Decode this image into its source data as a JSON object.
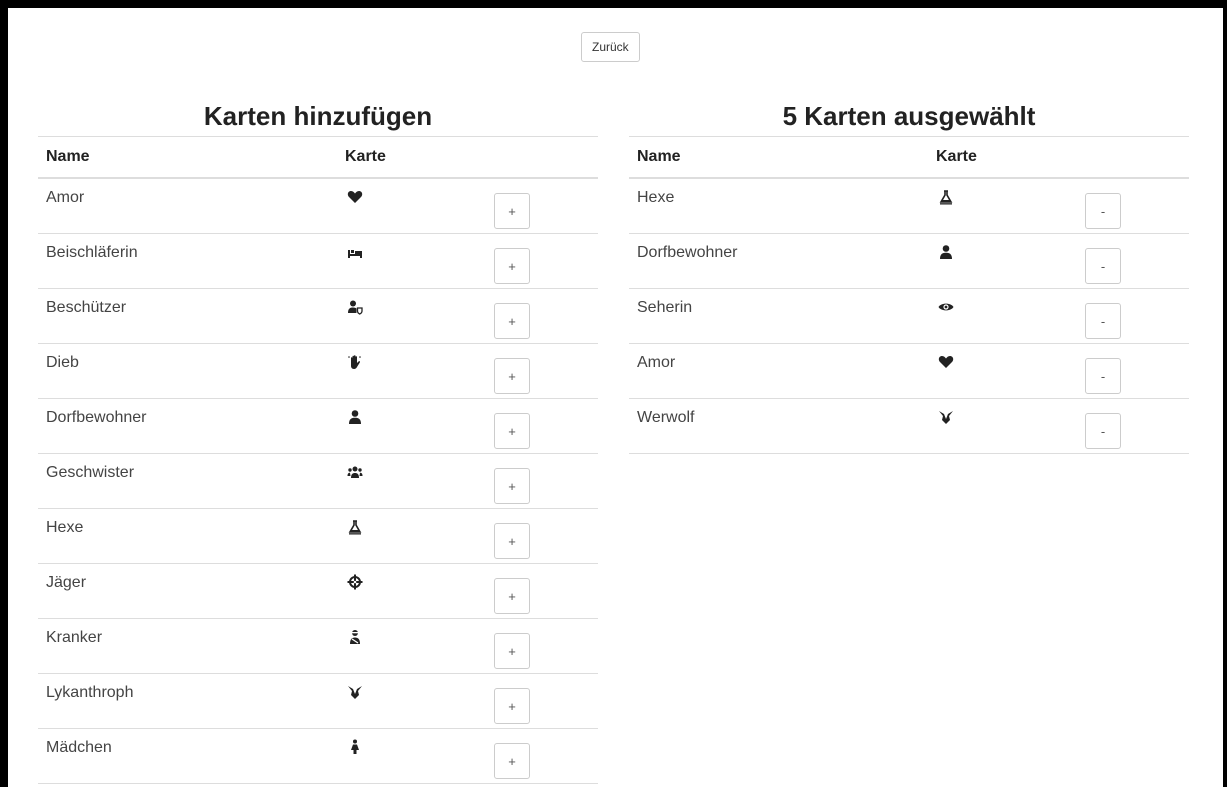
{
  "back_label": "Zurück",
  "left": {
    "title": "Karten hinzufügen",
    "headers": [
      "Name",
      "Karte"
    ],
    "action_label": "+",
    "rows": [
      {
        "name": "Amor",
        "icon": "heart-icon"
      },
      {
        "name": "Beischläferin",
        "icon": "bed-icon"
      },
      {
        "name": "Beschützer",
        "icon": "user-shield-icon"
      },
      {
        "name": "Dieb",
        "icon": "hand-icon"
      },
      {
        "name": "Dorfbewohner",
        "icon": "user-icon"
      },
      {
        "name": "Geschwister",
        "icon": "users-icon"
      },
      {
        "name": "Hexe",
        "icon": "flask-icon"
      },
      {
        "name": "Jäger",
        "icon": "crosshairs-icon"
      },
      {
        "name": "Kranker",
        "icon": "user-injured-icon"
      },
      {
        "name": "Lykanthroph",
        "icon": "wolf-icon"
      },
      {
        "name": "Mädchen",
        "icon": "female-icon"
      }
    ]
  },
  "right": {
    "title": "5 Karten ausgewählt",
    "headers": [
      "Name",
      "Karte"
    ],
    "action_label": "-",
    "rows": [
      {
        "name": "Hexe",
        "icon": "flask-icon"
      },
      {
        "name": "Dorfbewohner",
        "icon": "user-icon"
      },
      {
        "name": "Seherin",
        "icon": "eye-icon"
      },
      {
        "name": "Amor",
        "icon": "heart-icon"
      },
      {
        "name": "Werwolf",
        "icon": "wolf-icon"
      }
    ]
  }
}
